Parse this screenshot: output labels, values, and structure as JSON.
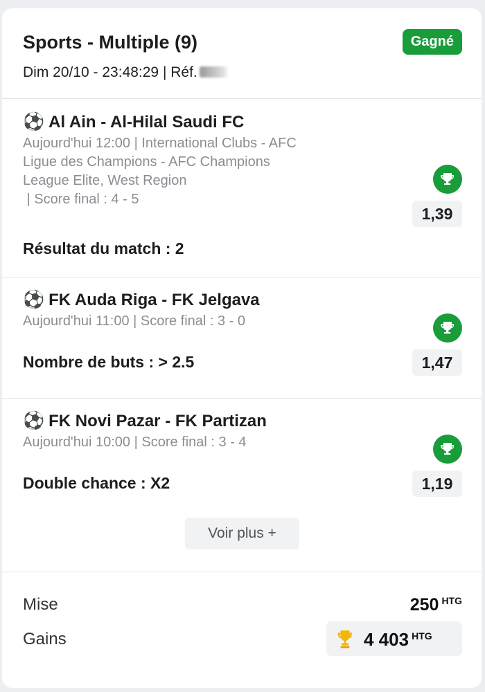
{
  "header": {
    "title": "Sports - Multiple (9)",
    "datetime_ref": "Dim 20/10 - 23:48:29 | Réf.",
    "status": "Gagné"
  },
  "selections": [
    {
      "teams": "Al Ain - Al-Hilal Saudi FC",
      "info_lines": [
        "Aujourd'hui 12:00 |  International Clubs  -  AFC",
        "Ligue des Champions  -  AFC Champions",
        "League Elite, West Region",
        " | Score final : 4 - 5"
      ],
      "market": "Résultat du match : 2",
      "odds": "1,39",
      "icon": "trophy-icon"
    },
    {
      "teams": "FK Auda Riga - FK Jelgava",
      "info_lines": [
        "Aujourd'hui 11:00 | Score final : 3 - 0"
      ],
      "market": "Nombre de buts : > 2.5",
      "odds": "1,47",
      "icon": "trophy-icon"
    },
    {
      "teams": "FK Novi Pazar - FK Partizan",
      "info_lines": [
        "Aujourd'hui 10:00 | Score final : 3 - 4"
      ],
      "market": "Double chance : X2",
      "odds": "1,19",
      "icon": "trophy-icon"
    }
  ],
  "more_button": "Voir plus +",
  "summary": {
    "stake_label": "Mise",
    "stake_value": "250",
    "stake_currency": "HTG",
    "winnings_label": "Gains",
    "winnings_value": "4 403",
    "winnings_currency": "HTG"
  },
  "colors": {
    "accent_green": "#199c3a",
    "trophy_gold": "#f2b705"
  }
}
